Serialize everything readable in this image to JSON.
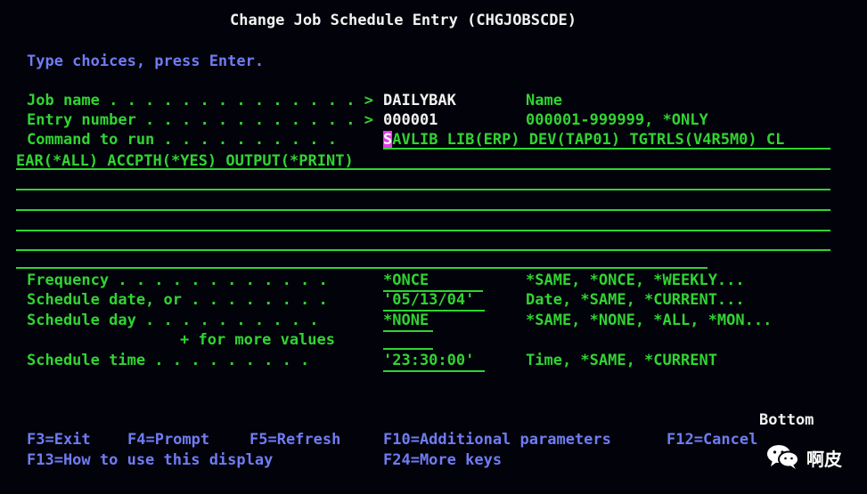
{
  "screen": {
    "title": "Change Job Schedule Entry (CHGJOBSCDE)",
    "instructions": "Type choices, press Enter.",
    "bottom_indicator": "Bottom"
  },
  "fields": {
    "job_name": {
      "label": "Job name . . . . . . . . . . . . . . >",
      "value": "DAILYBAK",
      "hint": "Name"
    },
    "entry_number": {
      "label": "Entry number . . . . . . . . . . . . >",
      "value": "000001",
      "hint": "000001-999999, *ONLY"
    },
    "command": {
      "label": "Command to run . . . . . . . . . .",
      "cursor_char": "S",
      "value_rest": "AVLIB LIB(ERP) DEV(TAP01) TGTRLS(V4R5M0) CL",
      "value_line2": "EAR(*ALL) ACCPTH(*YES) OUTPUT(*PRINT)"
    },
    "frequency": {
      "label": "Frequency . . . . . . . . . . . .",
      "value": "*ONCE",
      "hint": "*SAME, *ONCE, *WEEKLY..."
    },
    "schedule_date": {
      "label": "Schedule date, or . . . . . . . .",
      "value": "'05/13/04'",
      "hint": "Date, *SAME, *CURRENT..."
    },
    "schedule_day": {
      "label": "Schedule day . . . . . . . . . .",
      "value": "*NONE",
      "hint": "*SAME, *NONE, *ALL, *MON...",
      "more_values": "+ for more values"
    },
    "schedule_time": {
      "label": "Schedule time . . . . . . . . .",
      "value": "'23:30:00'",
      "hint": "Time, *SAME, *CURRENT"
    }
  },
  "function_keys": {
    "f3": "F3=Exit",
    "f4": "F4=Prompt",
    "f5": "F5=Refresh",
    "f10": "F10=Additional parameters",
    "f12": "F12=Cancel",
    "f13": "F13=How to use this display",
    "f24": "F24=More keys"
  },
  "watermark": {
    "text": "啊皮",
    "icon": "wechat-icon"
  },
  "colors": {
    "background": "#02020a",
    "white": "#f2f2f2",
    "green": "#31d431",
    "blue": "#6f7cf2",
    "cursor": "#e43de6"
  }
}
